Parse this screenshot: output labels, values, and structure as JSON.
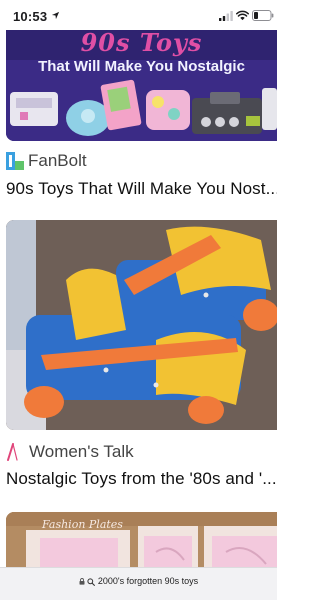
{
  "status_bar": {
    "time": "10:53",
    "icons": [
      "location-arrow-icon",
      "cellular-signal-icon",
      "wifi-icon",
      "battery-icon"
    ]
  },
  "feed": {
    "cards": [
      {
        "image_overlay_top": "90s Toys",
        "image_overlay_main": "That Will Make You Nostalgic",
        "source": "FanBolt",
        "source_icon": "fanbolt-logo-icon",
        "title": "90s Toys That Will Make You Nost..."
      },
      {
        "source": "Women's Talk",
        "source_icon": "womens-talk-logo-icon",
        "title": "Nostalgic Toys from the '80s and '..."
      },
      {
        "image_overlay_top": "Fashion Plates"
      }
    ]
  },
  "url_bar": {
    "text": "2000's forgotten 90s toys",
    "icons": [
      "lock-icon",
      "search-icon"
    ]
  },
  "colors": {
    "banner_bg": "#3b2b86",
    "banner_pink": "#e04fa5",
    "fanbolt_blue": "#3aa0e0",
    "fanbolt_green": "#5fc46a",
    "womens_talk_pink": "#e0457a"
  }
}
